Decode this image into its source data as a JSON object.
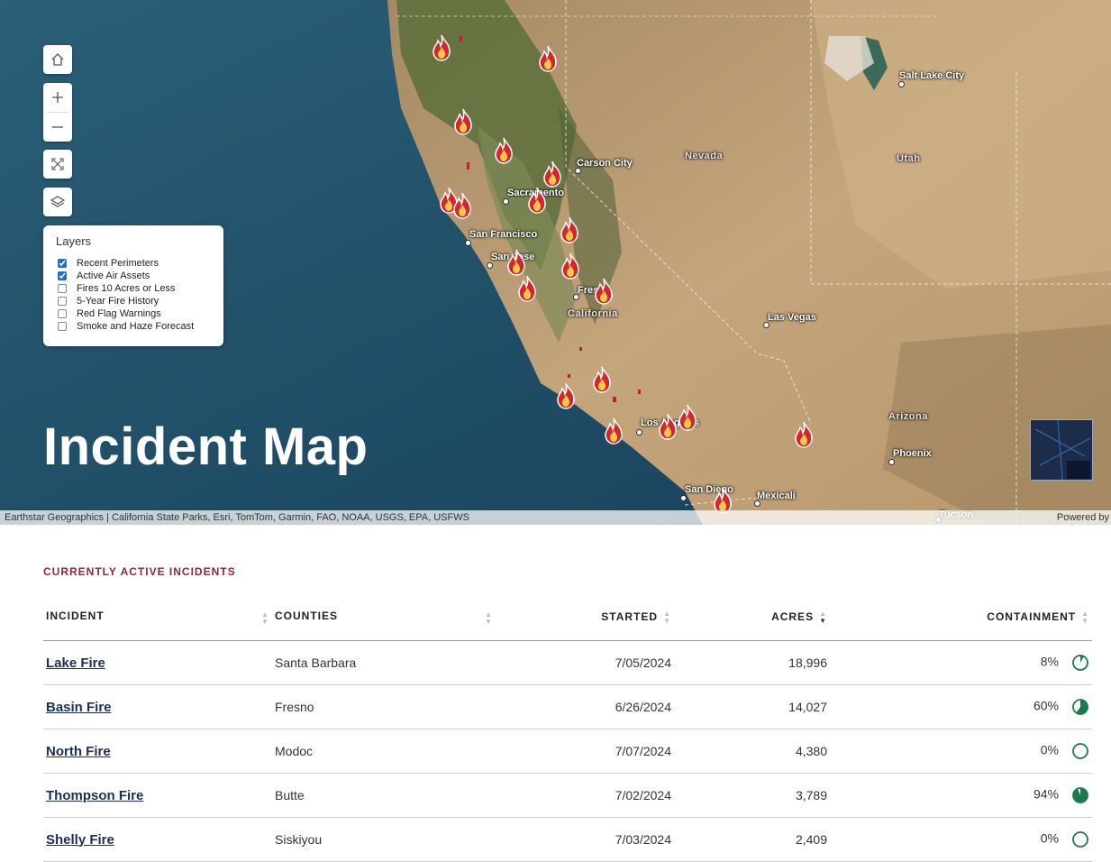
{
  "map": {
    "title": "Incident Map",
    "attribution": "Earthstar Geographics | California State Parks, Esri, TomTom, Garmin, FAO, NOAA, USGS, EPA, USFWS",
    "powered_by": "Powered by",
    "cities": [
      {
        "name": "Salt Lake City"
      },
      {
        "name": "Carson City"
      },
      {
        "name": "Sacramento"
      },
      {
        "name": "San Francisco"
      },
      {
        "name": "San Jose"
      },
      {
        "name": "Fresno"
      },
      {
        "name": "Las Vegas"
      },
      {
        "name": "Los Angeles"
      },
      {
        "name": "Phoenix"
      },
      {
        "name": "San Diego"
      },
      {
        "name": "Mexicali"
      },
      {
        "name": "Tucson"
      }
    ],
    "states": [
      "Nevada",
      "Utah",
      "California",
      "Arizona"
    ],
    "layers": {
      "title": "Layers",
      "items": [
        {
          "label": "Recent Perimeters",
          "checked": true
        },
        {
          "label": "Active Air Assets",
          "checked": true
        },
        {
          "label": "Fires 10 Acres or Less",
          "checked": false
        },
        {
          "label": "5-Year Fire History",
          "checked": false
        },
        {
          "label": "Red Flag Warnings",
          "checked": false
        },
        {
          "label": "Smoke and Haze Forecast",
          "checked": false
        }
      ]
    },
    "controls": [
      "home-icon",
      "zoom-in-icon",
      "zoom-out-icon",
      "fullscreen-icon",
      "layers-icon"
    ]
  },
  "incidents": {
    "heading": "CURRENTLY ACTIVE INCIDENTS",
    "columns": {
      "incident": "INCIDENT",
      "counties": "COUNTIES",
      "started": "STARTED",
      "acres": "ACRES",
      "containment": "CONTAINMENT"
    },
    "sorted_by": "acres",
    "rows": [
      {
        "name": "Lake Fire",
        "county": "Santa Barbara",
        "started": "7/05/2024",
        "acres": "18,996",
        "containment": "8%",
        "pct": 8
      },
      {
        "name": "Basin Fire",
        "county": "Fresno",
        "started": "6/26/2024",
        "acres": "14,027",
        "containment": "60%",
        "pct": 60
      },
      {
        "name": "North Fire",
        "county": "Modoc",
        "started": "7/07/2024",
        "acres": "4,380",
        "containment": "0%",
        "pct": 0
      },
      {
        "name": "Thompson Fire",
        "county": "Butte",
        "started": "7/02/2024",
        "acres": "3,789",
        "containment": "94%",
        "pct": 94
      },
      {
        "name": "Shelly Fire",
        "county": "Siskiyou",
        "started": "7/03/2024",
        "acres": "2,409",
        "containment": "0%",
        "pct": 0
      }
    ],
    "containment_color": "#1a7a4c"
  }
}
